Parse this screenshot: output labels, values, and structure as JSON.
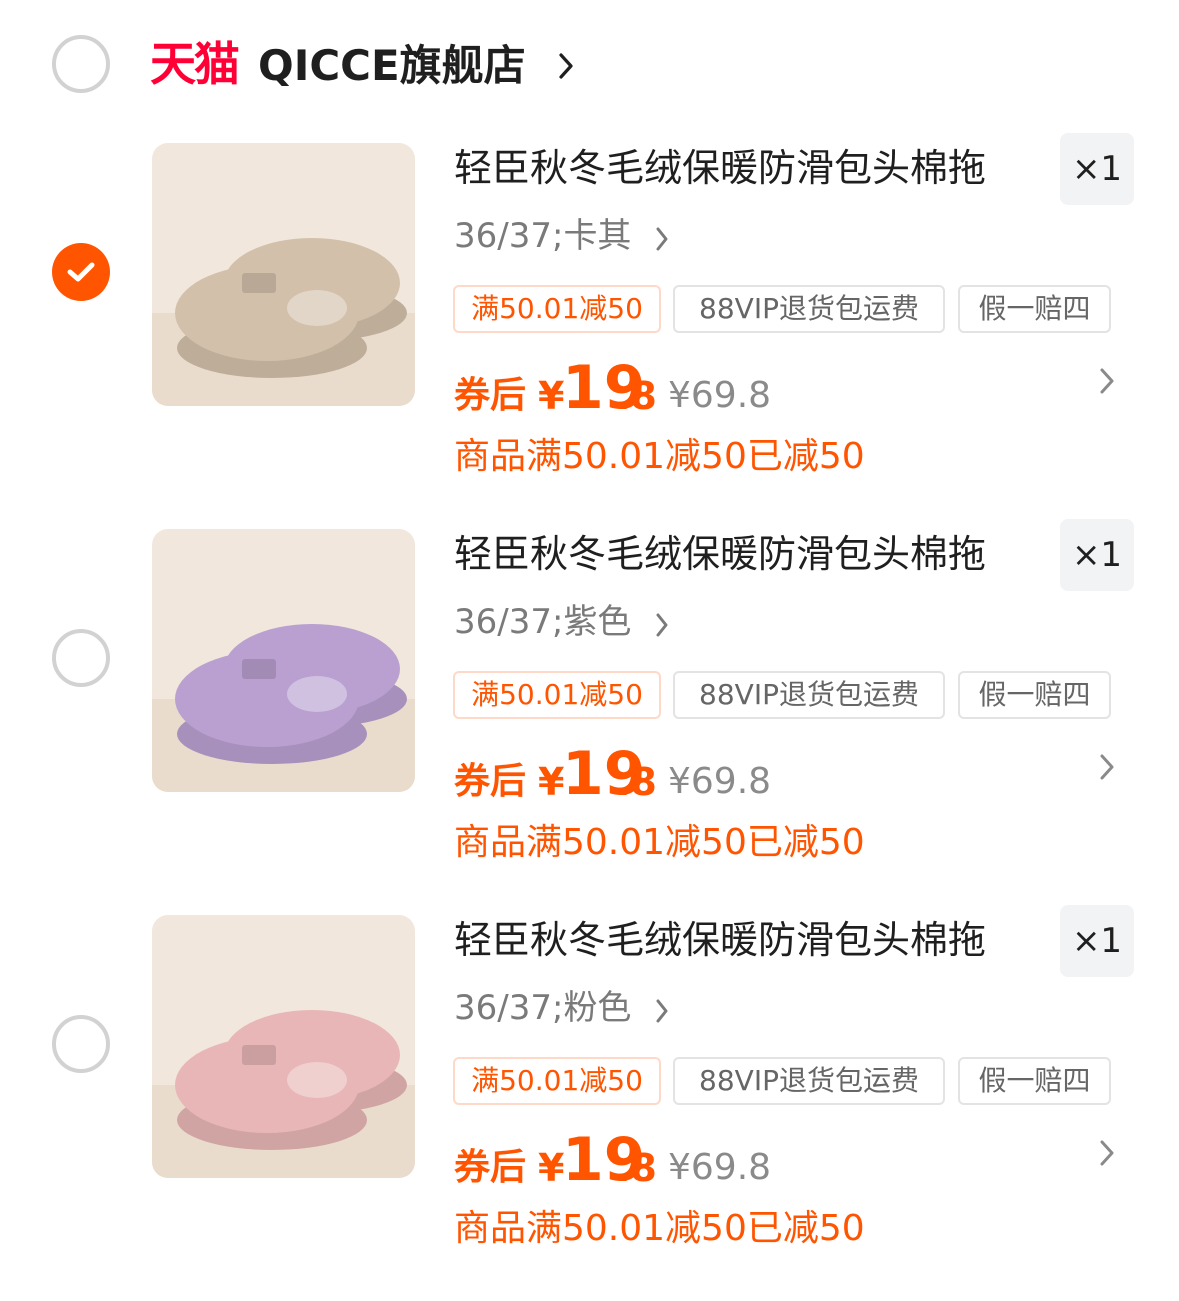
{
  "shop": {
    "brand": "天猫",
    "name": "QICCE旗舰店",
    "selected": false
  },
  "items": [
    {
      "selected": true,
      "title": "轻臣秋冬毛绒保暖防滑包头棉拖",
      "quantity": "×1",
      "sku": "36/37;卡其",
      "tags": [
        "满50.01减50",
        "88VIP退货包运费",
        "假一赔四"
      ],
      "price_label": "券后",
      "price_currency": "¥",
      "price_int": "19",
      "price_dec": ".8",
      "original_price": "¥69.8",
      "discount_note": "商品满50.01减50已减50",
      "thumb_color": "#d2c0aa"
    },
    {
      "selected": false,
      "title": "轻臣秋冬毛绒保暖防滑包头棉拖",
      "quantity": "×1",
      "sku": "36/37;紫色",
      "tags": [
        "满50.01减50",
        "88VIP退货包运费",
        "假一赔四"
      ],
      "price_label": "券后",
      "price_currency": "¥",
      "price_int": "19",
      "price_dec": ".8",
      "original_price": "¥69.8",
      "discount_note": "商品满50.01减50已减50",
      "thumb_color": "#b9a0d0"
    },
    {
      "selected": false,
      "title": "轻臣秋冬毛绒保暖防滑包头棉拖",
      "quantity": "×1",
      "sku": "36/37;粉色",
      "tags": [
        "满50.01减50",
        "88VIP退货包运费",
        "假一赔四"
      ],
      "price_label": "券后",
      "price_currency": "¥",
      "price_int": "19",
      "price_dec": ".8",
      "original_price": "¥69.8",
      "discount_note": "商品满50.01减50已减50",
      "thumb_color": "#e8b6b6"
    }
  ],
  "colors": {
    "accent": "#ff5500",
    "tmall_red": "#ff0036",
    "radio_border": "#d2d2d2"
  }
}
